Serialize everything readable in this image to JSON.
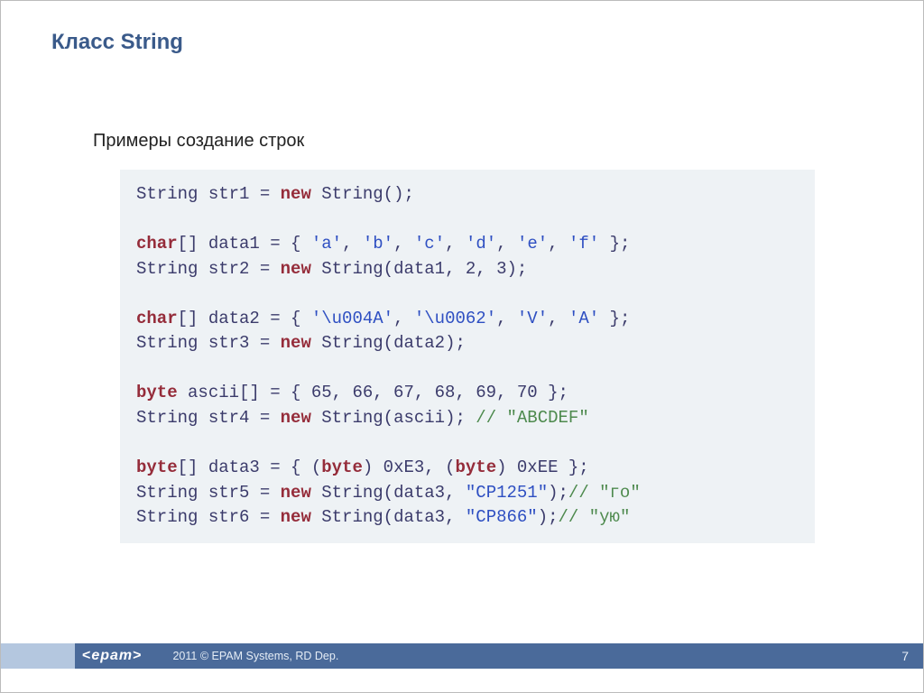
{
  "slide": {
    "title": "Класс String",
    "subtitle": "Примеры создание строк"
  },
  "code": {
    "lines": [
      [
        {
          "t": "type",
          "v": "String str1 = "
        },
        {
          "t": "keyword",
          "v": "new"
        },
        {
          "t": "type",
          "v": " String();"
        }
      ],
      [],
      [
        {
          "t": "keyword",
          "v": "char"
        },
        {
          "t": "type",
          "v": "[] data1 = { "
        },
        {
          "t": "string",
          "v": "'a'"
        },
        {
          "t": "type",
          "v": ", "
        },
        {
          "t": "string",
          "v": "'b'"
        },
        {
          "t": "type",
          "v": ", "
        },
        {
          "t": "string",
          "v": "'c'"
        },
        {
          "t": "type",
          "v": ", "
        },
        {
          "t": "string",
          "v": "'d'"
        },
        {
          "t": "type",
          "v": ", "
        },
        {
          "t": "string",
          "v": "'e'"
        },
        {
          "t": "type",
          "v": ", "
        },
        {
          "t": "string",
          "v": "'f'"
        },
        {
          "t": "type",
          "v": " };"
        }
      ],
      [
        {
          "t": "type",
          "v": "String str2 = "
        },
        {
          "t": "keyword",
          "v": "new"
        },
        {
          "t": "type",
          "v": " String(data1, 2, 3);"
        }
      ],
      [],
      [
        {
          "t": "keyword",
          "v": "char"
        },
        {
          "t": "type",
          "v": "[] data2 = { "
        },
        {
          "t": "string",
          "v": "'\\u004A'"
        },
        {
          "t": "type",
          "v": ", "
        },
        {
          "t": "string",
          "v": "'\\u0062'"
        },
        {
          "t": "type",
          "v": ", "
        },
        {
          "t": "string",
          "v": "'V'"
        },
        {
          "t": "type",
          "v": ", "
        },
        {
          "t": "string",
          "v": "'A'"
        },
        {
          "t": "type",
          "v": " };"
        }
      ],
      [
        {
          "t": "type",
          "v": "String str3 = "
        },
        {
          "t": "keyword",
          "v": "new"
        },
        {
          "t": "type",
          "v": " String(data2);"
        }
      ],
      [],
      [
        {
          "t": "keyword",
          "v": "byte"
        },
        {
          "t": "type",
          "v": " ascii[] = { 65, 66, 67, 68, 69, 70 };"
        }
      ],
      [
        {
          "t": "type",
          "v": "String str4 = "
        },
        {
          "t": "keyword",
          "v": "new"
        },
        {
          "t": "type",
          "v": " String(ascii); "
        },
        {
          "t": "comment",
          "v": "// \"ABCDEF\""
        }
      ],
      [],
      [
        {
          "t": "keyword",
          "v": "byte"
        },
        {
          "t": "type",
          "v": "[] data3 = { ("
        },
        {
          "t": "keyword",
          "v": "byte"
        },
        {
          "t": "type",
          "v": ") 0xE3, ("
        },
        {
          "t": "keyword",
          "v": "byte"
        },
        {
          "t": "type",
          "v": ") 0xEE };"
        }
      ],
      [
        {
          "t": "type",
          "v": "String str5 = "
        },
        {
          "t": "keyword",
          "v": "new"
        },
        {
          "t": "type",
          "v": " String(data3, "
        },
        {
          "t": "string",
          "v": "\"CP1251\""
        },
        {
          "t": "type",
          "v": ");"
        },
        {
          "t": "comment",
          "v": "// \"го\""
        }
      ],
      [
        {
          "t": "type",
          "v": "String str6 = "
        },
        {
          "t": "keyword",
          "v": "new"
        },
        {
          "t": "type",
          "v": " String(data3, "
        },
        {
          "t": "string",
          "v": "\"CP866\""
        },
        {
          "t": "type",
          "v": ");"
        },
        {
          "t": "comment",
          "v": "// \"ую\""
        }
      ]
    ]
  },
  "footer": {
    "logo_text": "epam",
    "copyright": "2011 © EPAM Systems, RD Dep.",
    "page": "7"
  }
}
